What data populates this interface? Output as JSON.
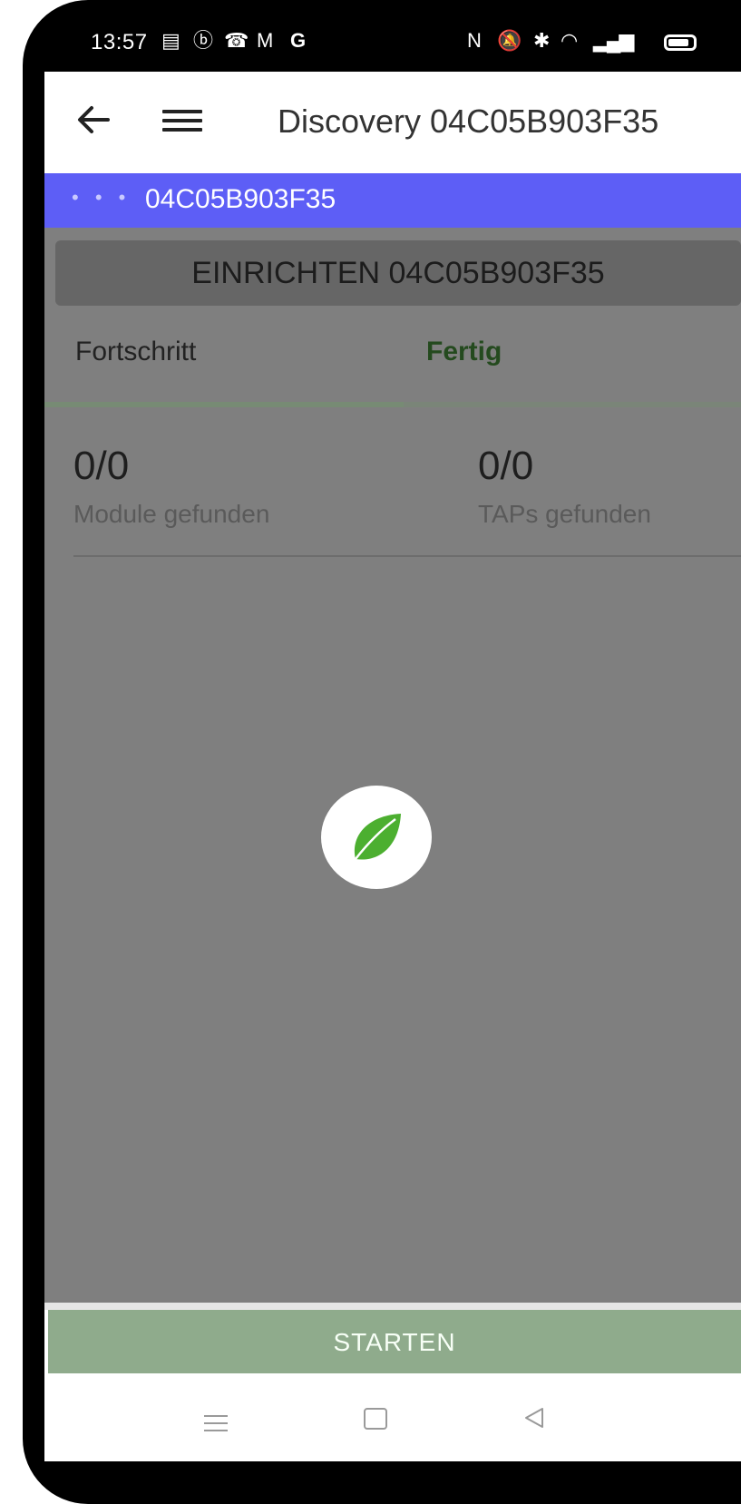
{
  "status_bar": {
    "time": "13:57",
    "left_icons": [
      "note-icon",
      "b-circle-icon",
      "missed-call-icon",
      "gmail-icon",
      "google-icon"
    ],
    "right_icons": [
      "nfc-icon",
      "mute-icon",
      "bluetooth-icon",
      "wifi-icon",
      "signal-icon",
      "battery-icon"
    ]
  },
  "app_bar": {
    "title": "Discovery 04C05B903F35"
  },
  "sub_bar": {
    "dots": "• • •",
    "label": "04C05B903F35"
  },
  "setup_header": "EINRICHTEN 04C05B903F35",
  "tabs": [
    {
      "label": "Fortschritt",
      "active": false
    },
    {
      "label": "Fertig",
      "active": true
    }
  ],
  "stats": [
    {
      "value": "0/0",
      "label": "Module gefunden"
    },
    {
      "value": "0/0",
      "label": "TAPs gefunden"
    }
  ],
  "start_button": "STARTEN",
  "colors": {
    "accent": "#5d5ef6",
    "overlay": "#7f7f7f",
    "start": "#8fab8c",
    "leaf": "#4caf30"
  }
}
